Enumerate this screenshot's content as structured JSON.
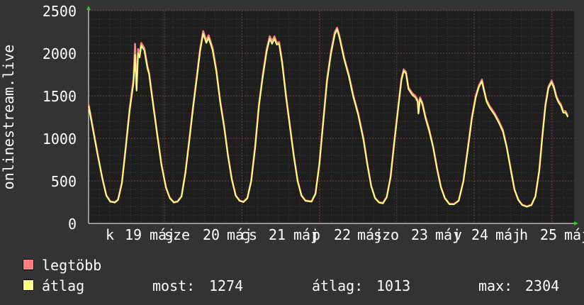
{
  "chart_data": {
    "type": "line",
    "ylabel": "onlinestream.live",
    "ylim": [
      0,
      2500
    ],
    "yticks": [
      0,
      500,
      1000,
      1500,
      2000,
      2500
    ],
    "x_labels": [
      "k",
      "19",
      "máj",
      "sze",
      "20",
      "máj",
      "cs",
      "21",
      "máj",
      "p",
      "22",
      "máj",
      "szo",
      "23",
      "máj",
      "v",
      "24",
      "máj",
      "h",
      "25",
      "máj"
    ],
    "grid": true,
    "colors": {
      "background": "#333333",
      "plot": "#1e1e1e",
      "grid": "#6e3a3a",
      "axis": "#ffffff",
      "text": "#ffffff",
      "max_series": "#ff7f7f",
      "avg_series": "#ffff7f",
      "arrow": "#22cc22"
    },
    "series": [
      {
        "name": "legtöbb",
        "color": "#ff7f7f",
        "values": [
          [
            0,
            1400
          ],
          [
            0.06,
            1100
          ],
          [
            0.12,
            800
          ],
          [
            0.18,
            520
          ],
          [
            0.23,
            330
          ],
          [
            0.28,
            260
          ],
          [
            0.34,
            250
          ],
          [
            0.38,
            280
          ],
          [
            0.43,
            480
          ],
          [
            0.48,
            900
          ],
          [
            0.53,
            1350
          ],
          [
            0.58,
            1700
          ],
          [
            0.6,
            2110
          ],
          [
            0.62,
            1580
          ],
          [
            0.64,
            2050
          ],
          [
            0.66,
            1980
          ],
          [
            0.68,
            2120
          ],
          [
            0.72,
            2060
          ],
          [
            0.76,
            1850
          ],
          [
            0.78,
            1780
          ],
          [
            0.82,
            1500
          ],
          [
            0.88,
            1100
          ],
          [
            0.94,
            700
          ],
          [
            1,
            420
          ],
          [
            1.05,
            300
          ],
          [
            1.1,
            250
          ],
          [
            1.15,
            260
          ],
          [
            1.2,
            320
          ],
          [
            1.25,
            600
          ],
          [
            1.3,
            980
          ],
          [
            1.35,
            1380
          ],
          [
            1.4,
            1750
          ],
          [
            1.44,
            2050
          ],
          [
            1.48,
            2260
          ],
          [
            1.52,
            2150
          ],
          [
            1.55,
            2210
          ],
          [
            1.6,
            2070
          ],
          [
            1.65,
            1800
          ],
          [
            1.7,
            1440
          ],
          [
            1.75,
            1150
          ],
          [
            1.8,
            800
          ],
          [
            1.85,
            520
          ],
          [
            1.9,
            330
          ],
          [
            1.95,
            270
          ],
          [
            2,
            255
          ],
          [
            2.05,
            300
          ],
          [
            2.1,
            500
          ],
          [
            2.15,
            900
          ],
          [
            2.2,
            1400
          ],
          [
            2.25,
            1750
          ],
          [
            2.3,
            2050
          ],
          [
            2.34,
            2200
          ],
          [
            2.37,
            2140
          ],
          [
            2.4,
            2200
          ],
          [
            2.43,
            2120
          ],
          [
            2.46,
            2130
          ],
          [
            2.5,
            1900
          ],
          [
            2.55,
            1500
          ],
          [
            2.6,
            1150
          ],
          [
            2.65,
            800
          ],
          [
            2.7,
            500
          ],
          [
            2.75,
            330
          ],
          [
            2.8,
            270
          ],
          [
            2.88,
            260
          ],
          [
            2.93,
            350
          ],
          [
            2.98,
            700
          ],
          [
            3.03,
            1200
          ],
          [
            3.08,
            1700
          ],
          [
            3.13,
            2020
          ],
          [
            3.18,
            2250
          ],
          [
            3.21,
            2300
          ],
          [
            3.24,
            2200
          ],
          [
            3.3,
            1950
          ],
          [
            3.36,
            1750
          ],
          [
            3.42,
            1500
          ],
          [
            3.48,
            1300
          ],
          [
            3.55,
            1000
          ],
          [
            3.6,
            700
          ],
          [
            3.65,
            440
          ],
          [
            3.7,
            300
          ],
          [
            3.75,
            250
          ],
          [
            3.8,
            240
          ],
          [
            3.85,
            310
          ],
          [
            3.9,
            550
          ],
          [
            3.95,
            980
          ],
          [
            4,
            1380
          ],
          [
            4.04,
            1700
          ],
          [
            4.07,
            1810
          ],
          [
            4.1,
            1780
          ],
          [
            4.13,
            1600
          ],
          [
            4.18,
            1530
          ],
          [
            4.22,
            1500
          ],
          [
            4.25,
            1450
          ],
          [
            4.26,
            1300
          ],
          [
            4.28,
            1480
          ],
          [
            4.31,
            1420
          ],
          [
            4.35,
            1260
          ],
          [
            4.4,
            1100
          ],
          [
            4.45,
            900
          ],
          [
            4.5,
            650
          ],
          [
            4.55,
            430
          ],
          [
            4.6,
            300
          ],
          [
            4.66,
            230
          ],
          [
            4.72,
            230
          ],
          [
            4.78,
            270
          ],
          [
            4.84,
            500
          ],
          [
            4.9,
            900
          ],
          [
            4.95,
            1250
          ],
          [
            5,
            1500
          ],
          [
            5.04,
            1620
          ],
          [
            5.08,
            1690
          ],
          [
            5.1,
            1600
          ],
          [
            5.14,
            1450
          ],
          [
            5.18,
            1380
          ],
          [
            5.24,
            1300
          ],
          [
            5.3,
            1200
          ],
          [
            5.35,
            1100
          ],
          [
            5.4,
            900
          ],
          [
            5.45,
            650
          ],
          [
            5.5,
            400
          ],
          [
            5.55,
            280
          ],
          [
            5.6,
            220
          ],
          [
            5.66,
            200
          ],
          [
            5.72,
            220
          ],
          [
            5.77,
            320
          ],
          [
            5.82,
            620
          ],
          [
            5.86,
            1030
          ],
          [
            5.9,
            1400
          ],
          [
            5.94,
            1610
          ],
          [
            5.98,
            1680
          ],
          [
            6.01,
            1610
          ],
          [
            6.04,
            1500
          ],
          [
            6.07,
            1440
          ],
          [
            6.1,
            1400
          ],
          [
            6.13,
            1320
          ],
          [
            6.16,
            1320
          ],
          [
            6.19,
            1260
          ]
        ]
      },
      {
        "name": "átlag",
        "color": "#ffff7f",
        "values": [
          [
            0,
            1380
          ],
          [
            0.06,
            1080
          ],
          [
            0.12,
            790
          ],
          [
            0.18,
            515
          ],
          [
            0.23,
            325
          ],
          [
            0.28,
            255
          ],
          [
            0.34,
            245
          ],
          [
            0.38,
            275
          ],
          [
            0.43,
            470
          ],
          [
            0.48,
            880
          ],
          [
            0.53,
            1320
          ],
          [
            0.58,
            1650
          ],
          [
            0.6,
            1980
          ],
          [
            0.62,
            1560
          ],
          [
            0.64,
            2000
          ],
          [
            0.66,
            1950
          ],
          [
            0.68,
            2090
          ],
          [
            0.72,
            2030
          ],
          [
            0.76,
            1820
          ],
          [
            0.78,
            1760
          ],
          [
            0.82,
            1480
          ],
          [
            0.88,
            1080
          ],
          [
            0.94,
            690
          ],
          [
            1,
            415
          ],
          [
            1.05,
            295
          ],
          [
            1.1,
            245
          ],
          [
            1.15,
            255
          ],
          [
            1.2,
            315
          ],
          [
            1.25,
            590
          ],
          [
            1.3,
            960
          ],
          [
            1.35,
            1360
          ],
          [
            1.4,
            1720
          ],
          [
            1.44,
            2020
          ],
          [
            1.48,
            2230
          ],
          [
            1.52,
            2120
          ],
          [
            1.55,
            2180
          ],
          [
            1.6,
            2040
          ],
          [
            1.65,
            1780
          ],
          [
            1.7,
            1420
          ],
          [
            1.75,
            1130
          ],
          [
            1.8,
            790
          ],
          [
            1.85,
            515
          ],
          [
            1.9,
            325
          ],
          [
            1.95,
            265
          ],
          [
            2,
            250
          ],
          [
            2.05,
            295
          ],
          [
            2.1,
            490
          ],
          [
            2.15,
            880
          ],
          [
            2.2,
            1380
          ],
          [
            2.25,
            1720
          ],
          [
            2.3,
            2020
          ],
          [
            2.34,
            2170
          ],
          [
            2.37,
            2110
          ],
          [
            2.4,
            2170
          ],
          [
            2.43,
            2100
          ],
          [
            2.46,
            2110
          ],
          [
            2.5,
            1880
          ],
          [
            2.55,
            1480
          ],
          [
            2.6,
            1130
          ],
          [
            2.65,
            790
          ],
          [
            2.7,
            495
          ],
          [
            2.75,
            325
          ],
          [
            2.8,
            265
          ],
          [
            2.88,
            255
          ],
          [
            2.93,
            345
          ],
          [
            2.98,
            690
          ],
          [
            3.03,
            1180
          ],
          [
            3.08,
            1670
          ],
          [
            3.13,
            1990
          ],
          [
            3.18,
            2220
          ],
          [
            3.21,
            2280
          ],
          [
            3.24,
            2180
          ],
          [
            3.3,
            1930
          ],
          [
            3.36,
            1730
          ],
          [
            3.42,
            1480
          ],
          [
            3.48,
            1280
          ],
          [
            3.55,
            980
          ],
          [
            3.6,
            690
          ],
          [
            3.65,
            435
          ],
          [
            3.7,
            295
          ],
          [
            3.75,
            245
          ],
          [
            3.8,
            235
          ],
          [
            3.85,
            305
          ],
          [
            3.9,
            540
          ],
          [
            3.95,
            960
          ],
          [
            4,
            1360
          ],
          [
            4.04,
            1680
          ],
          [
            4.07,
            1790
          ],
          [
            4.1,
            1760
          ],
          [
            4.13,
            1580
          ],
          [
            4.18,
            1510
          ],
          [
            4.22,
            1480
          ],
          [
            4.25,
            1430
          ],
          [
            4.26,
            1290
          ],
          [
            4.28,
            1460
          ],
          [
            4.31,
            1400
          ],
          [
            4.35,
            1240
          ],
          [
            4.4,
            1080
          ],
          [
            4.45,
            890
          ],
          [
            4.5,
            640
          ],
          [
            4.55,
            425
          ],
          [
            4.6,
            295
          ],
          [
            4.66,
            225
          ],
          [
            4.72,
            225
          ],
          [
            4.78,
            265
          ],
          [
            4.84,
            490
          ],
          [
            4.9,
            880
          ],
          [
            4.95,
            1230
          ],
          [
            5,
            1480
          ],
          [
            5.04,
            1600
          ],
          [
            5.08,
            1670
          ],
          [
            5.1,
            1580
          ],
          [
            5.14,
            1430
          ],
          [
            5.18,
            1360
          ],
          [
            5.24,
            1280
          ],
          [
            5.3,
            1180
          ],
          [
            5.35,
            1080
          ],
          [
            5.4,
            890
          ],
          [
            5.45,
            640
          ],
          [
            5.5,
            395
          ],
          [
            5.55,
            275
          ],
          [
            5.6,
            215
          ],
          [
            5.66,
            195
          ],
          [
            5.72,
            215
          ],
          [
            5.77,
            315
          ],
          [
            5.82,
            610
          ],
          [
            5.86,
            1010
          ],
          [
            5.9,
            1380
          ],
          [
            5.94,
            1590
          ],
          [
            5.98,
            1660
          ],
          [
            6.01,
            1590
          ],
          [
            6.04,
            1480
          ],
          [
            6.07,
            1420
          ],
          [
            6.1,
            1380
          ],
          [
            6.13,
            1300
          ],
          [
            6.16,
            1300
          ],
          [
            6.19,
            1250
          ]
        ]
      }
    ]
  },
  "legend": {
    "max_label": "legtöbb",
    "avg_label": "átlag",
    "stats": {
      "most_label": "most:",
      "most_value": "1274",
      "avg_label": "átlag:",
      "avg_value": "1013",
      "max_label": "max:",
      "max_value": "2304"
    }
  }
}
